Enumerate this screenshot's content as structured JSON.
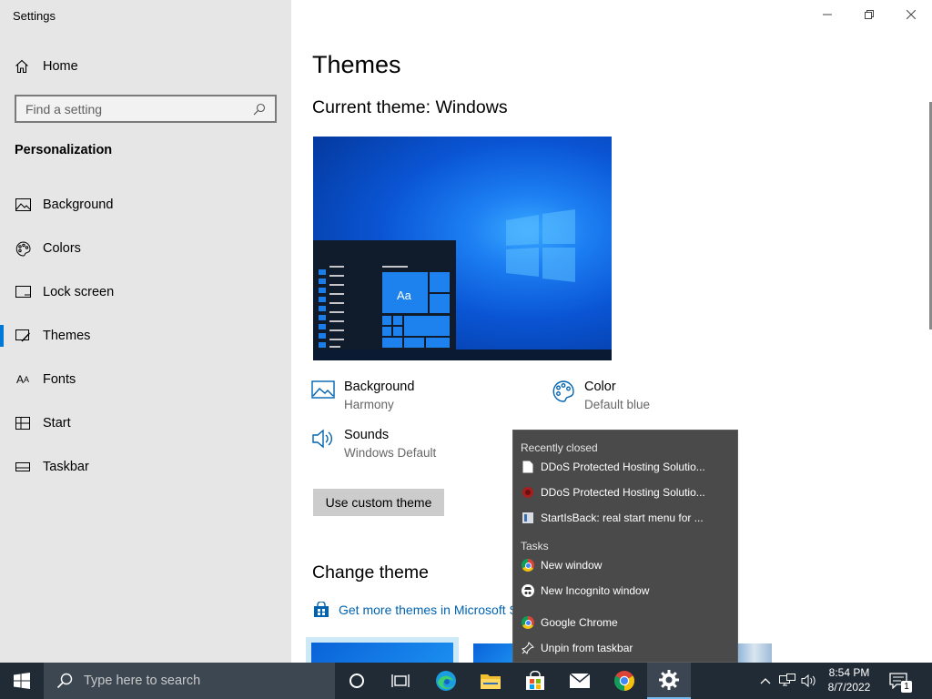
{
  "window": {
    "title": "Settings"
  },
  "sidebar": {
    "home_label": "Home",
    "search_placeholder": "Find a setting",
    "section": "Personalization",
    "items": [
      {
        "label": "Background",
        "icon": "picture-icon"
      },
      {
        "label": "Colors",
        "icon": "palette-icon"
      },
      {
        "label": "Lock screen",
        "icon": "lock-screen-icon"
      },
      {
        "label": "Themes",
        "icon": "brush-icon",
        "active": true
      },
      {
        "label": "Fonts",
        "icon": "font-icon"
      },
      {
        "label": "Start",
        "icon": "start-icon"
      },
      {
        "label": "Taskbar",
        "icon": "taskbar-icon"
      }
    ]
  },
  "main": {
    "title": "Themes",
    "current_theme": "Current theme: Windows",
    "preview_tile_label": "Aa",
    "attributes": {
      "background": {
        "title": "Background",
        "value": "Harmony"
      },
      "color": {
        "title": "Color",
        "value": "Default blue"
      },
      "sounds": {
        "title": "Sounds",
        "value": "Windows Default"
      }
    },
    "use_custom_button": "Use custom theme",
    "change_theme": "Change theme",
    "store_link": "Get more themes in Microsoft S"
  },
  "jumplist": {
    "recent_header": "Recently closed",
    "recent": [
      "DDoS Protected Hosting Solutio...",
      "DDoS Protected Hosting Solutio...",
      "StartIsBack: real start menu for ..."
    ],
    "tasks_header": "Tasks",
    "tasks": [
      "New window",
      "New Incognito window"
    ],
    "app_name": "Google Chrome",
    "unpin": "Unpin from taskbar"
  },
  "taskbar": {
    "search_placeholder": "Type here to search",
    "time": "8:54 PM",
    "date": "8/7/2022",
    "notification_count": "1"
  },
  "colors": {
    "accent": "#0078d7",
    "link": "#0063b1",
    "taskbar": "#202b36",
    "jumplist": "#4a4a4a",
    "sidebar": "#e6e6e6"
  }
}
